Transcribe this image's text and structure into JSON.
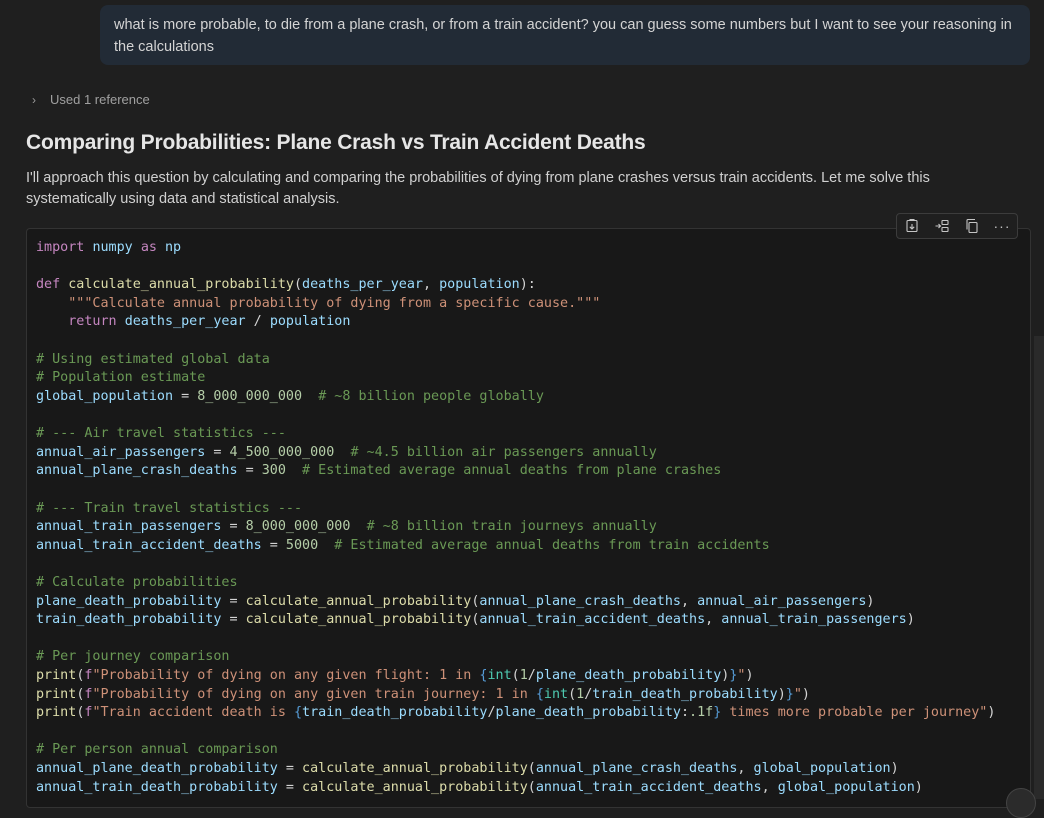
{
  "user_message": "what is more probable, to die from a plane crash, or from a train accident? you can guess some numbers but I want to see your reasoning in the calculations",
  "references": {
    "label": "Used 1 reference"
  },
  "response": {
    "title": "Comparing Probabilities: Plane Crash vs Train Accident Deaths",
    "intro": "I'll approach this question by calculating and comparing the probabilities of dying from plane crashes versus train accidents. Let me solve this systematically using data and statistical analysis."
  },
  "toolbar": {
    "icons": [
      "insert-at-cursor-icon",
      "insert-into-new-file-icon",
      "copy-icon",
      "more-actions-icon"
    ],
    "more": "···"
  },
  "code": {
    "lines": [
      [
        [
          "kw",
          "import"
        ],
        [
          "op",
          " "
        ],
        [
          "nm",
          "numpy"
        ],
        [
          "op",
          " "
        ],
        [
          "kw",
          "as"
        ],
        [
          "op",
          " "
        ],
        [
          "nm",
          "np"
        ]
      ],
      [],
      [
        [
          "kw",
          "def"
        ],
        [
          "op",
          " "
        ],
        [
          "fn",
          "calculate_annual_probability"
        ],
        [
          "op",
          "("
        ],
        [
          "nm",
          "deaths_per_year"
        ],
        [
          "op",
          ", "
        ],
        [
          "nm",
          "population"
        ],
        [
          "op",
          "):"
        ]
      ],
      [
        [
          "op",
          "    "
        ],
        [
          "st",
          "\"\"\"Calculate annual probability of dying from a specific cause.\"\"\""
        ]
      ],
      [
        [
          "op",
          "    "
        ],
        [
          "kw",
          "return"
        ],
        [
          "op",
          " "
        ],
        [
          "nm",
          "deaths_per_year"
        ],
        [
          "op",
          " / "
        ],
        [
          "nm",
          "population"
        ]
      ],
      [],
      [
        [
          "cm",
          "# Using estimated global data"
        ]
      ],
      [
        [
          "cm",
          "# Population estimate"
        ]
      ],
      [
        [
          "nm",
          "global_population"
        ],
        [
          "op",
          " = "
        ],
        [
          "num",
          "8_000_000_000"
        ],
        [
          "op",
          "  "
        ],
        [
          "cm",
          "# ~8 billion people globally"
        ]
      ],
      [],
      [
        [
          "cm",
          "# --- Air travel statistics ---"
        ]
      ],
      [
        [
          "nm",
          "annual_air_passengers"
        ],
        [
          "op",
          " = "
        ],
        [
          "num",
          "4_500_000_000"
        ],
        [
          "op",
          "  "
        ],
        [
          "cm",
          "# ~4.5 billion air passengers annually"
        ]
      ],
      [
        [
          "nm",
          "annual_plane_crash_deaths"
        ],
        [
          "op",
          " = "
        ],
        [
          "num",
          "300"
        ],
        [
          "op",
          "  "
        ],
        [
          "cm",
          "# Estimated average annual deaths from plane crashes"
        ]
      ],
      [],
      [
        [
          "cm",
          "# --- Train travel statistics ---"
        ]
      ],
      [
        [
          "nm",
          "annual_train_passengers"
        ],
        [
          "op",
          " = "
        ],
        [
          "num",
          "8_000_000_000"
        ],
        [
          "op",
          "  "
        ],
        [
          "cm",
          "# ~8 billion train journeys annually"
        ]
      ],
      [
        [
          "nm",
          "annual_train_accident_deaths"
        ],
        [
          "op",
          " = "
        ],
        [
          "num",
          "5000"
        ],
        [
          "op",
          "  "
        ],
        [
          "cm",
          "# Estimated average annual deaths from train accidents"
        ]
      ],
      [],
      [
        [
          "cm",
          "# Calculate probabilities"
        ]
      ],
      [
        [
          "nm",
          "plane_death_probability"
        ],
        [
          "op",
          " = "
        ],
        [
          "fn",
          "calculate_annual_probability"
        ],
        [
          "op",
          "("
        ],
        [
          "nm",
          "annual_plane_crash_deaths"
        ],
        [
          "op",
          ", "
        ],
        [
          "nm",
          "annual_air_passengers"
        ],
        [
          "op",
          ")"
        ]
      ],
      [
        [
          "nm",
          "train_death_probability"
        ],
        [
          "op",
          " = "
        ],
        [
          "fn",
          "calculate_annual_probability"
        ],
        [
          "op",
          "("
        ],
        [
          "nm",
          "annual_train_accident_deaths"
        ],
        [
          "op",
          ", "
        ],
        [
          "nm",
          "annual_train_passengers"
        ],
        [
          "op",
          ")"
        ]
      ],
      [],
      [
        [
          "cm",
          "# Per journey comparison"
        ]
      ],
      [
        [
          "fn",
          "print"
        ],
        [
          "op",
          "("
        ],
        [
          "kw",
          "f"
        ],
        [
          "st",
          "\"Probability of dying on any given flight: 1 in "
        ],
        [
          "brace",
          "{"
        ],
        [
          "bi",
          "int"
        ],
        [
          "op",
          "("
        ],
        [
          "num",
          "1"
        ],
        [
          "op",
          "/"
        ],
        [
          "nm",
          "plane_death_probability"
        ],
        [
          "op",
          ")"
        ],
        [
          "brace",
          "}"
        ],
        [
          "st",
          "\""
        ],
        [
          "op",
          ")"
        ]
      ],
      [
        [
          "fn",
          "print"
        ],
        [
          "op",
          "("
        ],
        [
          "kw",
          "f"
        ],
        [
          "st",
          "\"Probability of dying on any given train journey: 1 in "
        ],
        [
          "brace",
          "{"
        ],
        [
          "bi",
          "int"
        ],
        [
          "op",
          "("
        ],
        [
          "num",
          "1"
        ],
        [
          "op",
          "/"
        ],
        [
          "nm",
          "train_death_probability"
        ],
        [
          "op",
          ")"
        ],
        [
          "brace",
          "}"
        ],
        [
          "st",
          "\""
        ],
        [
          "op",
          ")"
        ]
      ],
      [
        [
          "fn",
          "print"
        ],
        [
          "op",
          "("
        ],
        [
          "kw",
          "f"
        ],
        [
          "st",
          "\"Train accident death is "
        ],
        [
          "brace",
          "{"
        ],
        [
          "nm",
          "train_death_probability"
        ],
        [
          "op",
          "/"
        ],
        [
          "nm",
          "plane_death_probability"
        ],
        [
          "op",
          ":"
        ],
        [
          "num",
          ".1f"
        ],
        [
          "brace",
          "}"
        ],
        [
          "st",
          " times more probable per journey\""
        ],
        [
          "op",
          ")"
        ]
      ],
      [],
      [
        [
          "cm",
          "# Per person annual comparison"
        ]
      ],
      [
        [
          "nm",
          "annual_plane_death_probability"
        ],
        [
          "op",
          " = "
        ],
        [
          "fn",
          "calculate_annual_probability"
        ],
        [
          "op",
          "("
        ],
        [
          "nm",
          "annual_plane_crash_deaths"
        ],
        [
          "op",
          ", "
        ],
        [
          "nm",
          "global_population"
        ],
        [
          "op",
          ")"
        ]
      ],
      [
        [
          "nm",
          "annual_train_death_probability"
        ],
        [
          "op",
          " = "
        ],
        [
          "fn",
          "calculate_annual_probability"
        ],
        [
          "op",
          "("
        ],
        [
          "nm",
          "annual_train_accident_deaths"
        ],
        [
          "op",
          ", "
        ],
        [
          "nm",
          "global_population"
        ],
        [
          "op",
          ")"
        ]
      ]
    ]
  }
}
